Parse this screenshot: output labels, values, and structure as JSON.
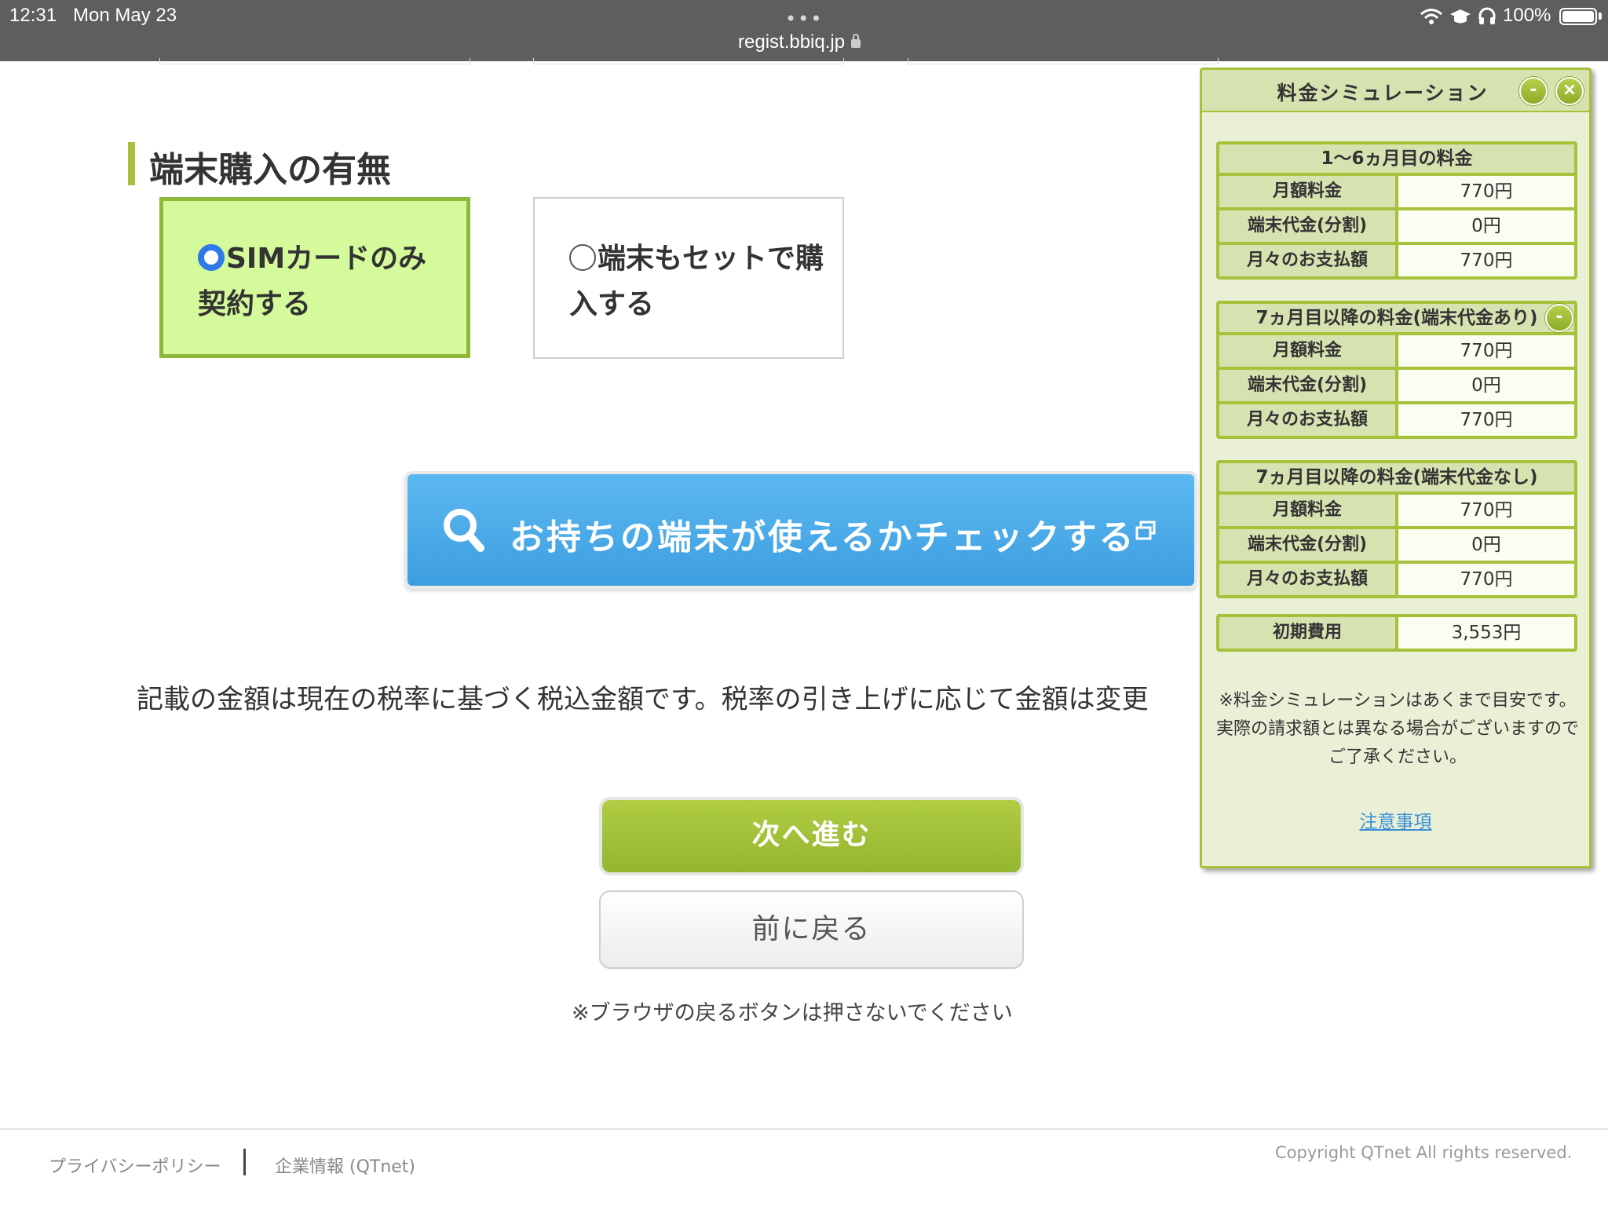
{
  "status_bar": {
    "time": "12:31",
    "date": "Mon May 23",
    "url": "regist.bbiq.jp",
    "battery": "100%",
    "icons": [
      "wifi-icon",
      "graduation-cap-icon",
      "headphones-icon",
      "battery-icon",
      "lock-icon"
    ]
  },
  "section": {
    "title": "端末購入の有無"
  },
  "options": {
    "sim_only": "SIMカードのみ契約する",
    "with_device": "端末もセットで購入する",
    "selected": "sim_only"
  },
  "check_button": {
    "label": "お持ちの端末が使えるかチェックする"
  },
  "tax_note": "記載の金額は現在の税率に基づく税込金額です。税率の引き上げに応じて金額は変更",
  "buttons": {
    "next": "次へ進む",
    "back": "前に戻る"
  },
  "browser_note": "※ブラウザの戻るボタンは押さないでください",
  "footer": {
    "privacy": "プライバシーポリシー",
    "company": "企業情報 (QTnet)",
    "copyright": "Copyright QTnet All rights reserved."
  },
  "simulation": {
    "title": "料金シミュレーション",
    "minimize": "-",
    "close": "×",
    "blocks": [
      {
        "heading": "1〜6ヵ月目の料金",
        "rows": [
          {
            "label": "月額料金",
            "value": "770円"
          },
          {
            "label": "端末代金(分割)",
            "value": "0円"
          },
          {
            "label": "月々のお支払額",
            "value": "770円"
          }
        ]
      },
      {
        "heading": "7ヵ月目以降の料金(端末代金あり)",
        "rows": [
          {
            "label": "月額料金",
            "value": "770円"
          },
          {
            "label": "端末代金(分割)",
            "value": "0円"
          },
          {
            "label": "月々のお支払額",
            "value": "770円"
          }
        ]
      },
      {
        "heading": "7ヵ月目以降の料金(端末代金なし)",
        "rows": [
          {
            "label": "月額料金",
            "value": "770円"
          },
          {
            "label": "端末代金(分割)",
            "value": "0円"
          },
          {
            "label": "月々のお支払額",
            "value": "770円"
          }
        ]
      }
    ],
    "initial": {
      "label": "初期費用",
      "value": "3,553円"
    },
    "note": "※料金シミュレーションはあくまで目安です。 実際の請求額とは異なる場合がございますのでご了承ください。",
    "link": "注意事項"
  },
  "colors": {
    "accent_green": "#a6c23b",
    "selected_bg": "#d4fa9b",
    "check_blue": "#3d9ee0",
    "panel_bg": "#eaf0d6"
  }
}
